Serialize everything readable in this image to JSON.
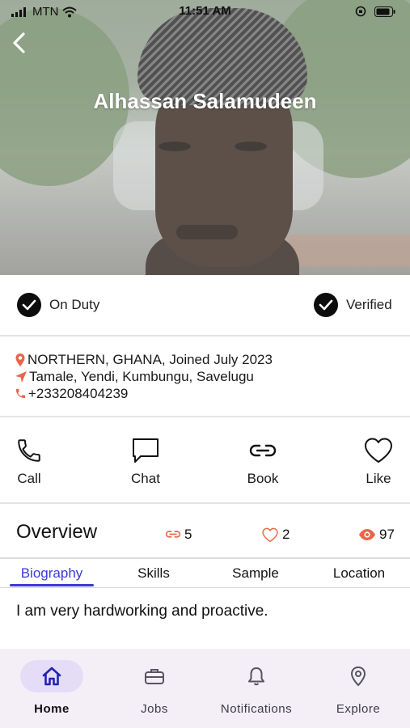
{
  "status_bar": {
    "carrier": "MTN",
    "time": "11:51 AM"
  },
  "profile": {
    "name": "Alhassan Salamudeen"
  },
  "badges": [
    {
      "label": "On Duty"
    },
    {
      "label": "Verified"
    }
  ],
  "info": {
    "region": "NORTHERN, GHANA, Joined July 2023",
    "areas": "Tamale, Yendi, Kumbungu, Savelugu",
    "phone": "+233208404239"
  },
  "actions": [
    {
      "label": "Call",
      "icon": "phone-icon"
    },
    {
      "label": "Chat",
      "icon": "chat-icon"
    },
    {
      "label": "Book",
      "icon": "link-icon"
    },
    {
      "label": "Like",
      "icon": "heart-icon"
    }
  ],
  "overview": {
    "title": "Overview",
    "stats": [
      {
        "icon": "link-icon",
        "value": "5"
      },
      {
        "icon": "heart-icon",
        "value": "2"
      },
      {
        "icon": "eye-icon",
        "value": "97"
      }
    ]
  },
  "tabs": [
    {
      "label": "Biography",
      "active": true
    },
    {
      "label": "Skills",
      "active": false
    },
    {
      "label": "Sample",
      "active": false
    },
    {
      "label": "Location",
      "active": false
    }
  ],
  "biography": "I am very hardworking and proactive.",
  "bottom_nav": [
    {
      "label": "Home",
      "icon": "home-icon",
      "active": true
    },
    {
      "label": "Jobs",
      "icon": "briefcase-icon",
      "active": false
    },
    {
      "label": "Notifications",
      "icon": "bell-icon",
      "active": false
    },
    {
      "label": "Explore",
      "icon": "location-pin-icon",
      "active": false
    }
  ],
  "colors": {
    "accent": "#3a3ad6",
    "icon_orange": "#e8674a",
    "nav_bg": "#f4eff7",
    "nav_active_pill": "#e5dcf7"
  }
}
